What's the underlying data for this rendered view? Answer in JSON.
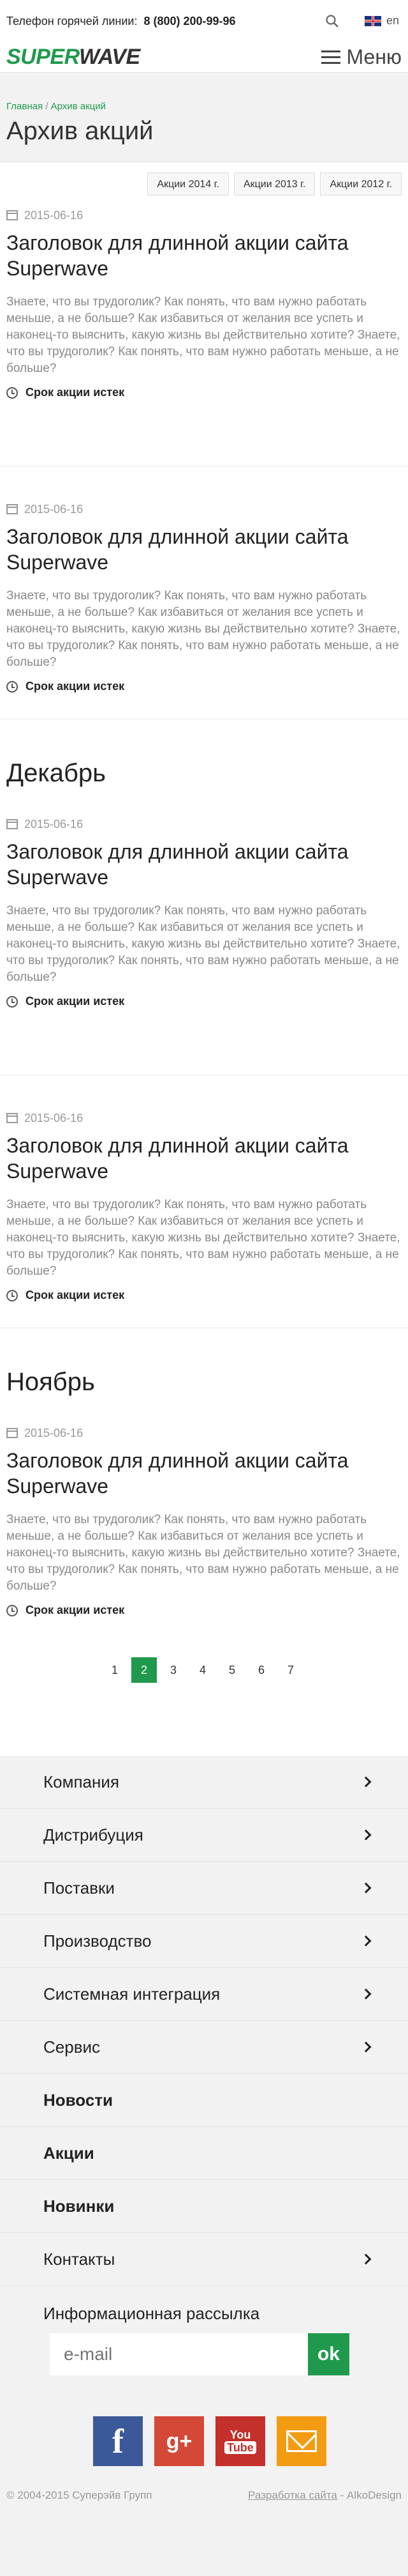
{
  "topbar": {
    "hotline_label": "Телефон горячей линии:",
    "hotline_phone": "8 (800) 200-99-96",
    "lang": "en"
  },
  "header": {
    "logo_accent": "SUPER",
    "logo_rest": "WAVE",
    "menu_label": "Меню"
  },
  "breadcrumbs": {
    "home": "Главная",
    "separator": "/",
    "current": "Архив акций"
  },
  "page_title": "Архив акций",
  "filters": [
    "Акции 2014 г.",
    "Акции 2013 г.",
    "Акции 2012 г."
  ],
  "promo_common": {
    "date": "2015-06-16",
    "title": "Заголовок для длинной акции сайта Superwave",
    "text": "Знаете, что вы трудоголик? Как понять, что вам нужно работать меньше, а не больше? Как избавиться от желания все успеть и наконец-то выяснить, какую жизнь вы действительно хотите? Знаете, что вы трудоголик? Как понять, что вам нужно работать меньше, а не больше?",
    "expired": "Срок акции истек"
  },
  "months": {
    "december": "Декабрь",
    "november": "Ноябрь"
  },
  "pagination": [
    "1",
    "2",
    "3",
    "4",
    "5",
    "6",
    "7"
  ],
  "pagination_active": "2",
  "footer": {
    "nav": [
      {
        "label": "Компания"
      },
      {
        "label": "Дистрибуция"
      },
      {
        "label": "Поставки"
      },
      {
        "label": "Производство"
      },
      {
        "label": "Системная интеграция"
      },
      {
        "label": "Сервис"
      },
      {
        "label": "Новости"
      },
      {
        "label": "Акции"
      },
      {
        "label": "Новинки"
      },
      {
        "label": "Контакты"
      }
    ],
    "newsletter_title": "Информационная рассылка",
    "email_placeholder": "e-mail",
    "submit_label": "ok",
    "socials": {
      "facebook": "f",
      "google_plus": "g+",
      "youtube_top": "You",
      "youtube_bottom": "Tube"
    },
    "copyright": "© 2004-2015 Суперэйв Групп",
    "dev_link": "Разработка сайта",
    "dev_sep": " - ",
    "dev_name": "AlkoDesign"
  },
  "colors": {
    "brand_green": "#1f9a4c",
    "footer_bg": "#f2f2f2"
  }
}
